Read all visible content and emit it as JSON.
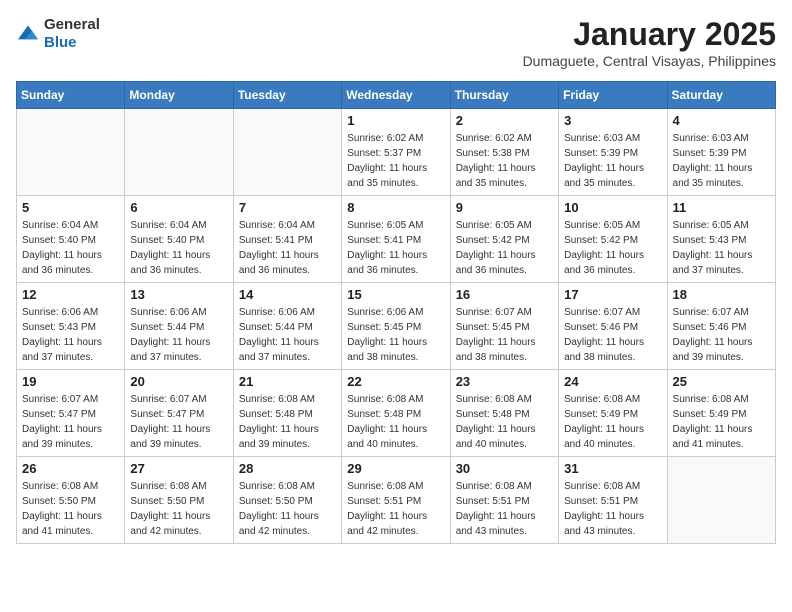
{
  "header": {
    "logo_general": "General",
    "logo_blue": "Blue",
    "month_title": "January 2025",
    "location": "Dumaguete, Central Visayas, Philippines"
  },
  "weekdays": [
    "Sunday",
    "Monday",
    "Tuesday",
    "Wednesday",
    "Thursday",
    "Friday",
    "Saturday"
  ],
  "weeks": [
    [
      {
        "day": "",
        "sunrise": "",
        "sunset": "",
        "daylight": ""
      },
      {
        "day": "",
        "sunrise": "",
        "sunset": "",
        "daylight": ""
      },
      {
        "day": "",
        "sunrise": "",
        "sunset": "",
        "daylight": ""
      },
      {
        "day": "1",
        "sunrise": "Sunrise: 6:02 AM",
        "sunset": "Sunset: 5:37 PM",
        "daylight": "Daylight: 11 hours and 35 minutes."
      },
      {
        "day": "2",
        "sunrise": "Sunrise: 6:02 AM",
        "sunset": "Sunset: 5:38 PM",
        "daylight": "Daylight: 11 hours and 35 minutes."
      },
      {
        "day": "3",
        "sunrise": "Sunrise: 6:03 AM",
        "sunset": "Sunset: 5:39 PM",
        "daylight": "Daylight: 11 hours and 35 minutes."
      },
      {
        "day": "4",
        "sunrise": "Sunrise: 6:03 AM",
        "sunset": "Sunset: 5:39 PM",
        "daylight": "Daylight: 11 hours and 35 minutes."
      }
    ],
    [
      {
        "day": "5",
        "sunrise": "Sunrise: 6:04 AM",
        "sunset": "Sunset: 5:40 PM",
        "daylight": "Daylight: 11 hours and 36 minutes."
      },
      {
        "day": "6",
        "sunrise": "Sunrise: 6:04 AM",
        "sunset": "Sunset: 5:40 PM",
        "daylight": "Daylight: 11 hours and 36 minutes."
      },
      {
        "day": "7",
        "sunrise": "Sunrise: 6:04 AM",
        "sunset": "Sunset: 5:41 PM",
        "daylight": "Daylight: 11 hours and 36 minutes."
      },
      {
        "day": "8",
        "sunrise": "Sunrise: 6:05 AM",
        "sunset": "Sunset: 5:41 PM",
        "daylight": "Daylight: 11 hours and 36 minutes."
      },
      {
        "day": "9",
        "sunrise": "Sunrise: 6:05 AM",
        "sunset": "Sunset: 5:42 PM",
        "daylight": "Daylight: 11 hours and 36 minutes."
      },
      {
        "day": "10",
        "sunrise": "Sunrise: 6:05 AM",
        "sunset": "Sunset: 5:42 PM",
        "daylight": "Daylight: 11 hours and 36 minutes."
      },
      {
        "day": "11",
        "sunrise": "Sunrise: 6:05 AM",
        "sunset": "Sunset: 5:43 PM",
        "daylight": "Daylight: 11 hours and 37 minutes."
      }
    ],
    [
      {
        "day": "12",
        "sunrise": "Sunrise: 6:06 AM",
        "sunset": "Sunset: 5:43 PM",
        "daylight": "Daylight: 11 hours and 37 minutes."
      },
      {
        "day": "13",
        "sunrise": "Sunrise: 6:06 AM",
        "sunset": "Sunset: 5:44 PM",
        "daylight": "Daylight: 11 hours and 37 minutes."
      },
      {
        "day": "14",
        "sunrise": "Sunrise: 6:06 AM",
        "sunset": "Sunset: 5:44 PM",
        "daylight": "Daylight: 11 hours and 37 minutes."
      },
      {
        "day": "15",
        "sunrise": "Sunrise: 6:06 AM",
        "sunset": "Sunset: 5:45 PM",
        "daylight": "Daylight: 11 hours and 38 minutes."
      },
      {
        "day": "16",
        "sunrise": "Sunrise: 6:07 AM",
        "sunset": "Sunset: 5:45 PM",
        "daylight": "Daylight: 11 hours and 38 minutes."
      },
      {
        "day": "17",
        "sunrise": "Sunrise: 6:07 AM",
        "sunset": "Sunset: 5:46 PM",
        "daylight": "Daylight: 11 hours and 38 minutes."
      },
      {
        "day": "18",
        "sunrise": "Sunrise: 6:07 AM",
        "sunset": "Sunset: 5:46 PM",
        "daylight": "Daylight: 11 hours and 39 minutes."
      }
    ],
    [
      {
        "day": "19",
        "sunrise": "Sunrise: 6:07 AM",
        "sunset": "Sunset: 5:47 PM",
        "daylight": "Daylight: 11 hours and 39 minutes."
      },
      {
        "day": "20",
        "sunrise": "Sunrise: 6:07 AM",
        "sunset": "Sunset: 5:47 PM",
        "daylight": "Daylight: 11 hours and 39 minutes."
      },
      {
        "day": "21",
        "sunrise": "Sunrise: 6:08 AM",
        "sunset": "Sunset: 5:48 PM",
        "daylight": "Daylight: 11 hours and 39 minutes."
      },
      {
        "day": "22",
        "sunrise": "Sunrise: 6:08 AM",
        "sunset": "Sunset: 5:48 PM",
        "daylight": "Daylight: 11 hours and 40 minutes."
      },
      {
        "day": "23",
        "sunrise": "Sunrise: 6:08 AM",
        "sunset": "Sunset: 5:48 PM",
        "daylight": "Daylight: 11 hours and 40 minutes."
      },
      {
        "day": "24",
        "sunrise": "Sunrise: 6:08 AM",
        "sunset": "Sunset: 5:49 PM",
        "daylight": "Daylight: 11 hours and 40 minutes."
      },
      {
        "day": "25",
        "sunrise": "Sunrise: 6:08 AM",
        "sunset": "Sunset: 5:49 PM",
        "daylight": "Daylight: 11 hours and 41 minutes."
      }
    ],
    [
      {
        "day": "26",
        "sunrise": "Sunrise: 6:08 AM",
        "sunset": "Sunset: 5:50 PM",
        "daylight": "Daylight: 11 hours and 41 minutes."
      },
      {
        "day": "27",
        "sunrise": "Sunrise: 6:08 AM",
        "sunset": "Sunset: 5:50 PM",
        "daylight": "Daylight: 11 hours and 42 minutes."
      },
      {
        "day": "28",
        "sunrise": "Sunrise: 6:08 AM",
        "sunset": "Sunset: 5:50 PM",
        "daylight": "Daylight: 11 hours and 42 minutes."
      },
      {
        "day": "29",
        "sunrise": "Sunrise: 6:08 AM",
        "sunset": "Sunset: 5:51 PM",
        "daylight": "Daylight: 11 hours and 42 minutes."
      },
      {
        "day": "30",
        "sunrise": "Sunrise: 6:08 AM",
        "sunset": "Sunset: 5:51 PM",
        "daylight": "Daylight: 11 hours and 43 minutes."
      },
      {
        "day": "31",
        "sunrise": "Sunrise: 6:08 AM",
        "sunset": "Sunset: 5:51 PM",
        "daylight": "Daylight: 11 hours and 43 minutes."
      },
      {
        "day": "",
        "sunrise": "",
        "sunset": "",
        "daylight": ""
      }
    ]
  ]
}
